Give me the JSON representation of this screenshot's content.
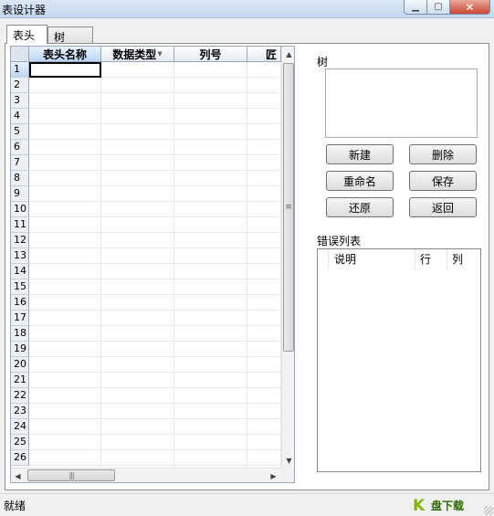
{
  "window": {
    "title": "表设计器",
    "minimize_icon": "minimize-icon",
    "maximize_icon": "maximize-icon",
    "close_icon": "close-icon"
  },
  "tabs": [
    {
      "label": "表头",
      "active": true
    },
    {
      "label": "树",
      "active": false
    }
  ],
  "grid": {
    "columns": [
      "表头名称",
      "数据类型",
      "列号",
      "匠"
    ],
    "row_numbers": [
      "1",
      "2",
      "3",
      "4",
      "5",
      "6",
      "7",
      "8",
      "9",
      "10",
      "11",
      "12",
      "13",
      "14",
      "15",
      "16",
      "17",
      "18",
      "19",
      "20",
      "21",
      "22",
      "23",
      "24",
      "25",
      "26"
    ],
    "selected_row": "1",
    "selected_column": "表头名称"
  },
  "tree_panel": {
    "label": "树",
    "buttons": {
      "new": "新建",
      "delete": "删除",
      "rename": "重命名",
      "save": "保存",
      "restore": "还原",
      "back": "返回"
    }
  },
  "error_list": {
    "label": "错误列表",
    "columns": [
      "说明",
      "行",
      "列"
    ]
  },
  "status": {
    "text": "就绪"
  },
  "logo": {
    "text": "盘下载"
  }
}
